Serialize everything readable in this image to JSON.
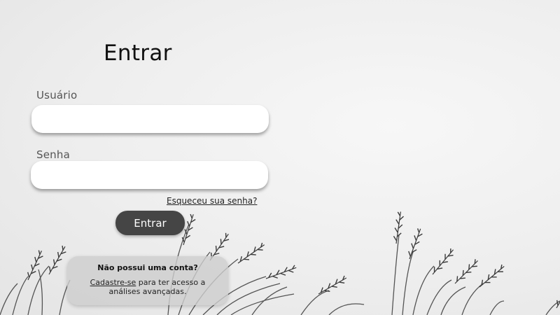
{
  "login": {
    "title": "Entrar",
    "username_label": "Usuário",
    "username_value": "",
    "password_label": "Senha",
    "password_value": "",
    "forgot_password": "Esqueceu sua senha?",
    "submit_label": "Entrar"
  },
  "signup": {
    "title": "Não possui uma conta?",
    "link": "Cadastre-se",
    "text": " para ter acesso a análises avançadas."
  },
  "background": {
    "image": "grass-silhouette-photo",
    "colors": {
      "sky": "#eeeeee",
      "plants": "#3a3a3a",
      "button": "#454545"
    }
  }
}
